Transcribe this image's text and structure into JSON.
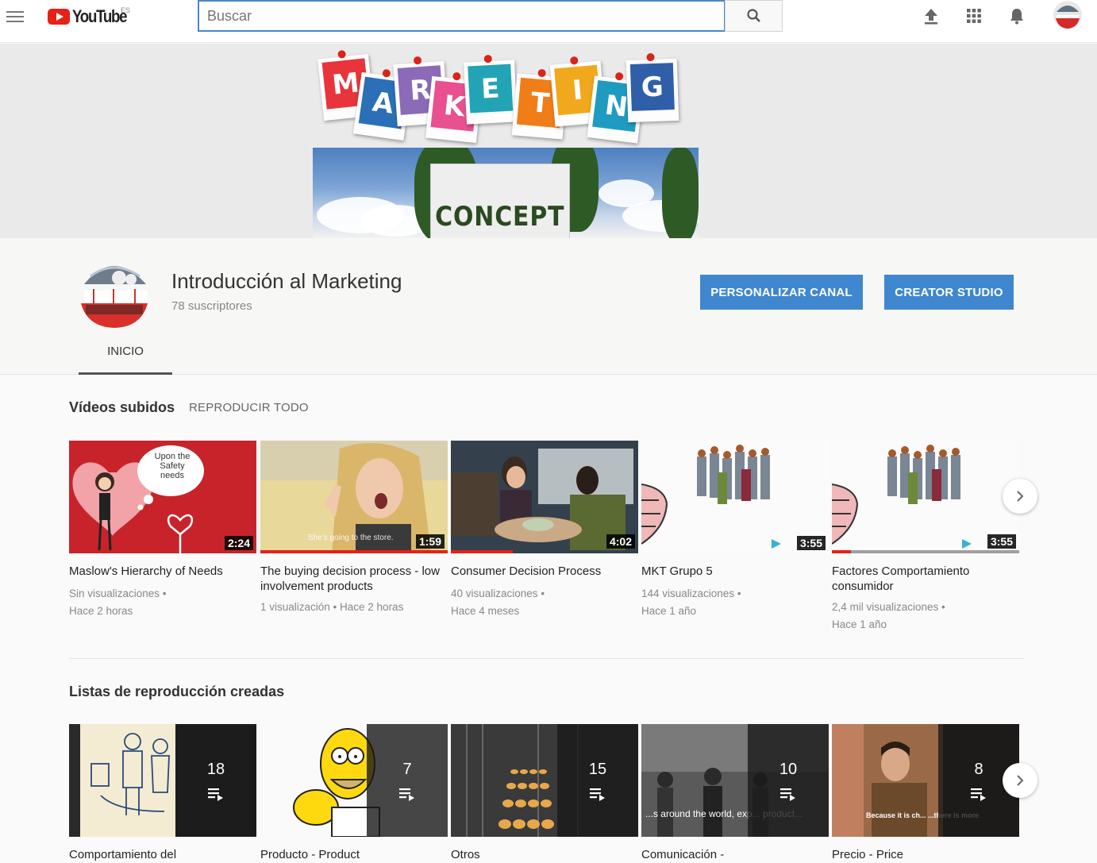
{
  "header": {
    "logo_text": "YouTube",
    "region": "ES",
    "search_placeholder": "Buscar",
    "icons": [
      "menu-icon",
      "search-icon",
      "upload-icon",
      "apps-icon",
      "notifications-icon"
    ]
  },
  "banner": {
    "letters": [
      "M",
      "A",
      "R",
      "K",
      "E",
      "T",
      "I",
      "N",
      "G"
    ],
    "letter_colors": [
      "#e8343b",
      "#2b6fb6",
      "#8b6bb8",
      "#e8508f",
      "#23a3b6",
      "#f07d18",
      "#f2a81d",
      "#1f9bc2",
      "#2f5fa8"
    ],
    "concept_text": "CONCEPT"
  },
  "channel": {
    "name": "Introducción al Marketing",
    "subscribers": "78 suscriptores",
    "customize_label": "PERSONALIZAR CANAL",
    "studio_label": "CREATOR STUDIO",
    "tab_home": "INICIO"
  },
  "uploads": {
    "title": "Vídeos subidos",
    "play_all": "REPRODUCIR TODO",
    "videos": [
      {
        "title": "Maslow's Hierarchy of Needs",
        "meta": "Sin visualizaciones •\nHace 2 horas",
        "duration": "2:24",
        "thumb_caption": "Upon the Safety needs",
        "progress": 0
      },
      {
        "title": "The buying decision process - low involvement products",
        "meta": "1 visualización • Hace 2 horas",
        "duration": "1:59",
        "thumb_caption": "She's going to the store.",
        "progress": 1.0
      },
      {
        "title": "Consumer Decision Process",
        "meta": "40 visualizaciones •\nHace 4 meses",
        "duration": "4:02",
        "thumb_caption": "",
        "progress": 0.33
      },
      {
        "title": "MKT Grupo 5",
        "meta": "144 visualizaciones •\nHace 1 año",
        "duration": "3:55",
        "thumb_caption": "",
        "progress": 0
      },
      {
        "title": "Factores Comportamiento consumidor",
        "meta": "2,4 mil visualizaciones •\nHace 1 año",
        "duration": "3:55",
        "thumb_caption": "",
        "progress": 0.1
      }
    ]
  },
  "playlists": {
    "title": "Listas de reproducción creadas",
    "items": [
      {
        "title": "Comportamiento del",
        "count": "18"
      },
      {
        "title": "Producto - Product",
        "count": "7"
      },
      {
        "title": "Otros",
        "count": "15"
      },
      {
        "title": "Comunicación -",
        "count": "10",
        "thumb_caption": "...s around the world, exp... product..."
      },
      {
        "title": "Precio - Price",
        "count": "8",
        "thumb_caption": "Because it is ch... ...there is more"
      }
    ]
  },
  "colors": {
    "accent_blue": "#3f87cf",
    "youtube_red": "#e62117",
    "search_border": "#4a86c8"
  }
}
